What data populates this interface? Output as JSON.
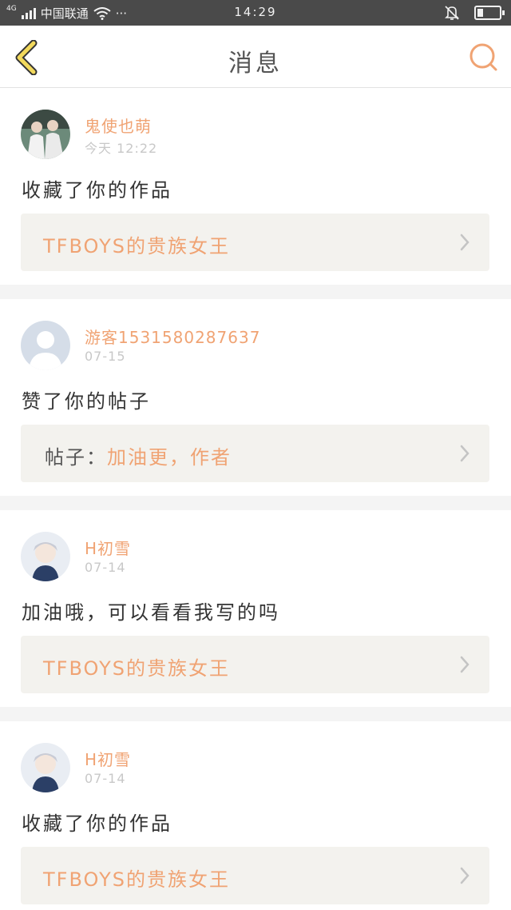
{
  "status_bar": {
    "network": "4G",
    "carrier": "中国联通",
    "more": "···",
    "time": "14:29",
    "mute_icon": "bell-off-icon",
    "battery_icon": "battery-icon"
  },
  "nav": {
    "back_icon": "chevron-left-icon",
    "title": "消息",
    "search_icon": "search-icon"
  },
  "colors": {
    "accent": "#f0a373",
    "back_arrow": "#f2d95c",
    "reference_bg": "#f3f2ee",
    "timestamp": "#c8c8c8"
  },
  "messages": [
    {
      "username": "鬼使也萌",
      "time": "今天 12:22",
      "action": "收藏了你的作品",
      "reference": {
        "prefix": "",
        "text": "TFBOYS的贵族女王"
      }
    },
    {
      "username": "游客1531580287637",
      "time": "07-15",
      "action": "赞了你的帖子",
      "reference": {
        "prefix": "帖子：",
        "text": "加油更，作者"
      }
    },
    {
      "username": "H初雪",
      "time": "07-14",
      "action": "加油哦，可以看看我写的吗",
      "reference": {
        "prefix": "",
        "text": "TFBOYS的贵族女王"
      }
    },
    {
      "username": "H初雪",
      "time": "07-14",
      "action": "收藏了你的作品",
      "reference": {
        "prefix": "",
        "text": "TFBOYS的贵族女王"
      }
    }
  ]
}
